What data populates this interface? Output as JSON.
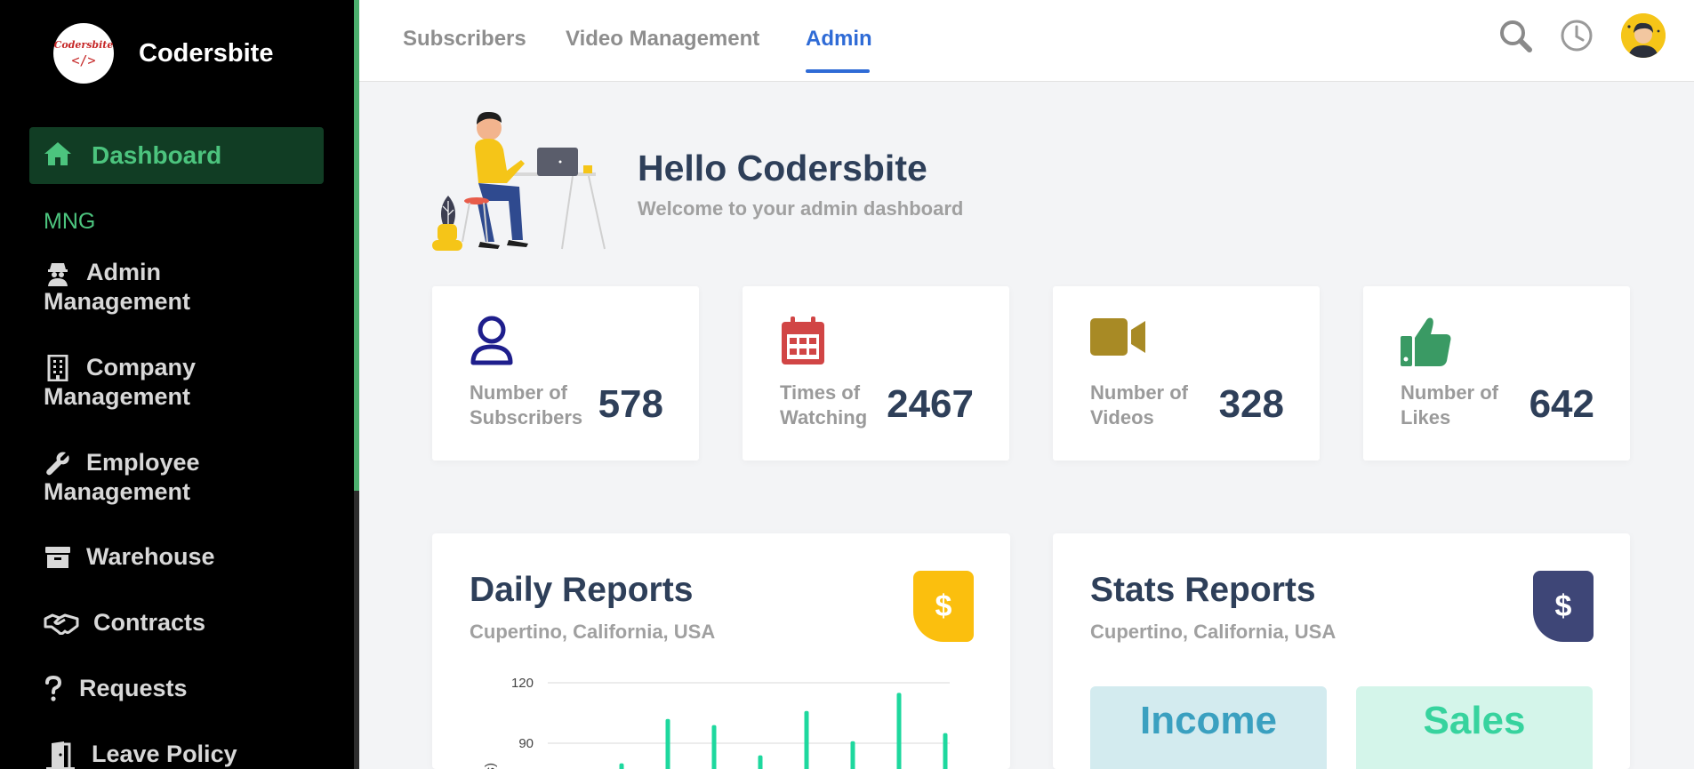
{
  "brand": {
    "logo_text": "Codersbite",
    "logo_code": "</>",
    "name": "Codersbite"
  },
  "sidebar": {
    "active": {
      "label": "Dashboard",
      "icon": "home-icon"
    },
    "section_title": "MNG",
    "items": [
      {
        "line1": "Admin",
        "line2": "Management",
        "icon": "user-secret-icon"
      },
      {
        "line1": "Company",
        "line2": "Management",
        "icon": "building-icon"
      },
      {
        "line1": "Employee",
        "line2": "Management",
        "icon": "wrench-icon"
      },
      {
        "line1": "Warehouse",
        "icon": "archive-box-icon"
      },
      {
        "line1": "Contracts",
        "icon": "handshake-icon"
      },
      {
        "line1": "Requests",
        "icon": "question-icon"
      },
      {
        "line1": "Leave Policy",
        "icon": "door-exit-icon"
      }
    ]
  },
  "tabs": [
    {
      "label": "Subscribers",
      "active": false
    },
    {
      "label": "Video Management",
      "active": false
    },
    {
      "label": "Admin",
      "active": true
    }
  ],
  "hero": {
    "title": "Hello Codersbite",
    "subtitle": "Welcome to your admin dashboard"
  },
  "stats": [
    {
      "label": "Number of Subscribers",
      "value": "578",
      "icon": "user-icon",
      "color": "#1e1e8c"
    },
    {
      "label": "Times of Watching",
      "value": "2467",
      "icon": "calendar-icon",
      "color": "#d14545"
    },
    {
      "label": "Number of Videos",
      "value": "328",
      "icon": "video-camera-icon",
      "color": "#a88a25"
    },
    {
      "label": "Number of Likes",
      "value": "642",
      "icon": "thumbs-up-icon",
      "color": "#3a9a64"
    }
  ],
  "daily_report": {
    "title": "Daily Reports",
    "subtitle": "Cupertino, California, USA",
    "badge": "$",
    "badge_color": "#fbbf0e"
  },
  "stats_report": {
    "title": "Stats Reports",
    "subtitle": "Cupertino, California, USA",
    "badge": "$",
    "badge_color": "#3e4677",
    "tiles": [
      {
        "label": "Income",
        "bg": "#d3ebef",
        "color": "#3aa0c0"
      },
      {
        "label": "Sales",
        "bg": "#d4f5ea",
        "color": "#37d39e"
      }
    ]
  },
  "chart_data": {
    "type": "bar",
    "ylabel": "(s)",
    "y_ticks": [
      "120",
      "90"
    ],
    "ylim": [
      0,
      120
    ],
    "values": [
      80,
      102,
      99,
      84,
      106,
      91,
      115,
      95
    ],
    "bar_color": "#1ed89e"
  }
}
